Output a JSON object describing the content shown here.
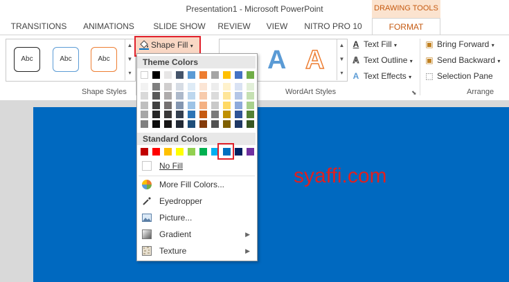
{
  "window": {
    "title": "Presentation1 - Microsoft PowerPoint",
    "context_tab_group": "DRAWING TOOLS"
  },
  "tabs": [
    {
      "label": "TRANSITIONS"
    },
    {
      "label": "ANIMATIONS"
    },
    {
      "label": "SLIDE SHOW"
    },
    {
      "label": "REVIEW"
    },
    {
      "label": "VIEW"
    },
    {
      "label": "NITRO PRO 10"
    },
    {
      "label": "FORMAT"
    }
  ],
  "ribbon": {
    "shape_styles": {
      "group_label": "Shape Styles",
      "presets": [
        {
          "label": "Abc",
          "border": "#222222"
        },
        {
          "label": "Abc",
          "border": "#5b9bd5"
        },
        {
          "label": "Abc",
          "border": "#ed7d31"
        }
      ],
      "shape_fill_label": "Shape Fill"
    },
    "wordart": {
      "group_label": "WordArt Styles",
      "text_fill": "Text Fill",
      "text_outline": "Text Outline",
      "text_effects": "Text Effects",
      "letters": [
        "A",
        "A"
      ]
    },
    "arrange": {
      "group_label": "Arrange",
      "bring_forward": "Bring Forward",
      "send_backward": "Send Backward",
      "selection_pane": "Selection Pane"
    }
  },
  "dropdown": {
    "theme_colors_header": "Theme Colors",
    "standard_colors_header": "Standard Colors",
    "theme_colors": [
      [
        "#ffffff",
        "#f2f2f2",
        "#d9d9d9",
        "#bfbfbf",
        "#a6a6a6",
        "#808080"
      ],
      [
        "#000000",
        "#7f7f7f",
        "#595959",
        "#404040",
        "#262626",
        "#0d0d0d"
      ],
      [
        "#e7e6e6",
        "#d0cece",
        "#aeabab",
        "#757171",
        "#3a3838",
        "#171616"
      ],
      [
        "#44546a",
        "#d6dce4",
        "#adb9ca",
        "#8496b0",
        "#333f4f",
        "#222a35"
      ],
      [
        "#5b9bd5",
        "#deebf6",
        "#bdd7ee",
        "#9dc3e6",
        "#2e75b5",
        "#1f4e79"
      ],
      [
        "#ed7d31",
        "#fbe5d5",
        "#f7cbac",
        "#f4b183",
        "#c55a11",
        "#843c0b"
      ],
      [
        "#a5a5a5",
        "#ededed",
        "#dbdbdb",
        "#c9c9c9",
        "#7b7b7b",
        "#525252"
      ],
      [
        "#ffc000",
        "#fff2cc",
        "#fee599",
        "#ffd965",
        "#bf9000",
        "#7f6000"
      ],
      [
        "#4472c4",
        "#d9e2f3",
        "#b4c6e7",
        "#8eaadb",
        "#2f5496",
        "#1f3864"
      ],
      [
        "#70ad47",
        "#e2efd9",
        "#c5e0b3",
        "#a8d08d",
        "#538135",
        "#375623"
      ]
    ],
    "standard_colors": [
      "#c00000",
      "#ff0000",
      "#ffc000",
      "#ffff00",
      "#92d050",
      "#00b050",
      "#00b0f0",
      "#0070c0",
      "#002060",
      "#7030a0"
    ],
    "selected_standard_index": 7,
    "items": [
      {
        "label": "No Fill",
        "icon": "no-fill-icon"
      },
      {
        "label": "More Fill Colors...",
        "icon": "color-wheel-icon"
      },
      {
        "label": "Eyedropper",
        "icon": "eyedropper-icon"
      },
      {
        "label": "Picture...",
        "icon": "picture-icon"
      },
      {
        "label": "Gradient",
        "icon": "gradient-icon",
        "submenu": true
      },
      {
        "label": "Texture",
        "icon": "texture-icon",
        "submenu": true
      }
    ]
  },
  "slide": {
    "background": "#0069c0",
    "watermark": "syaffi.com"
  }
}
